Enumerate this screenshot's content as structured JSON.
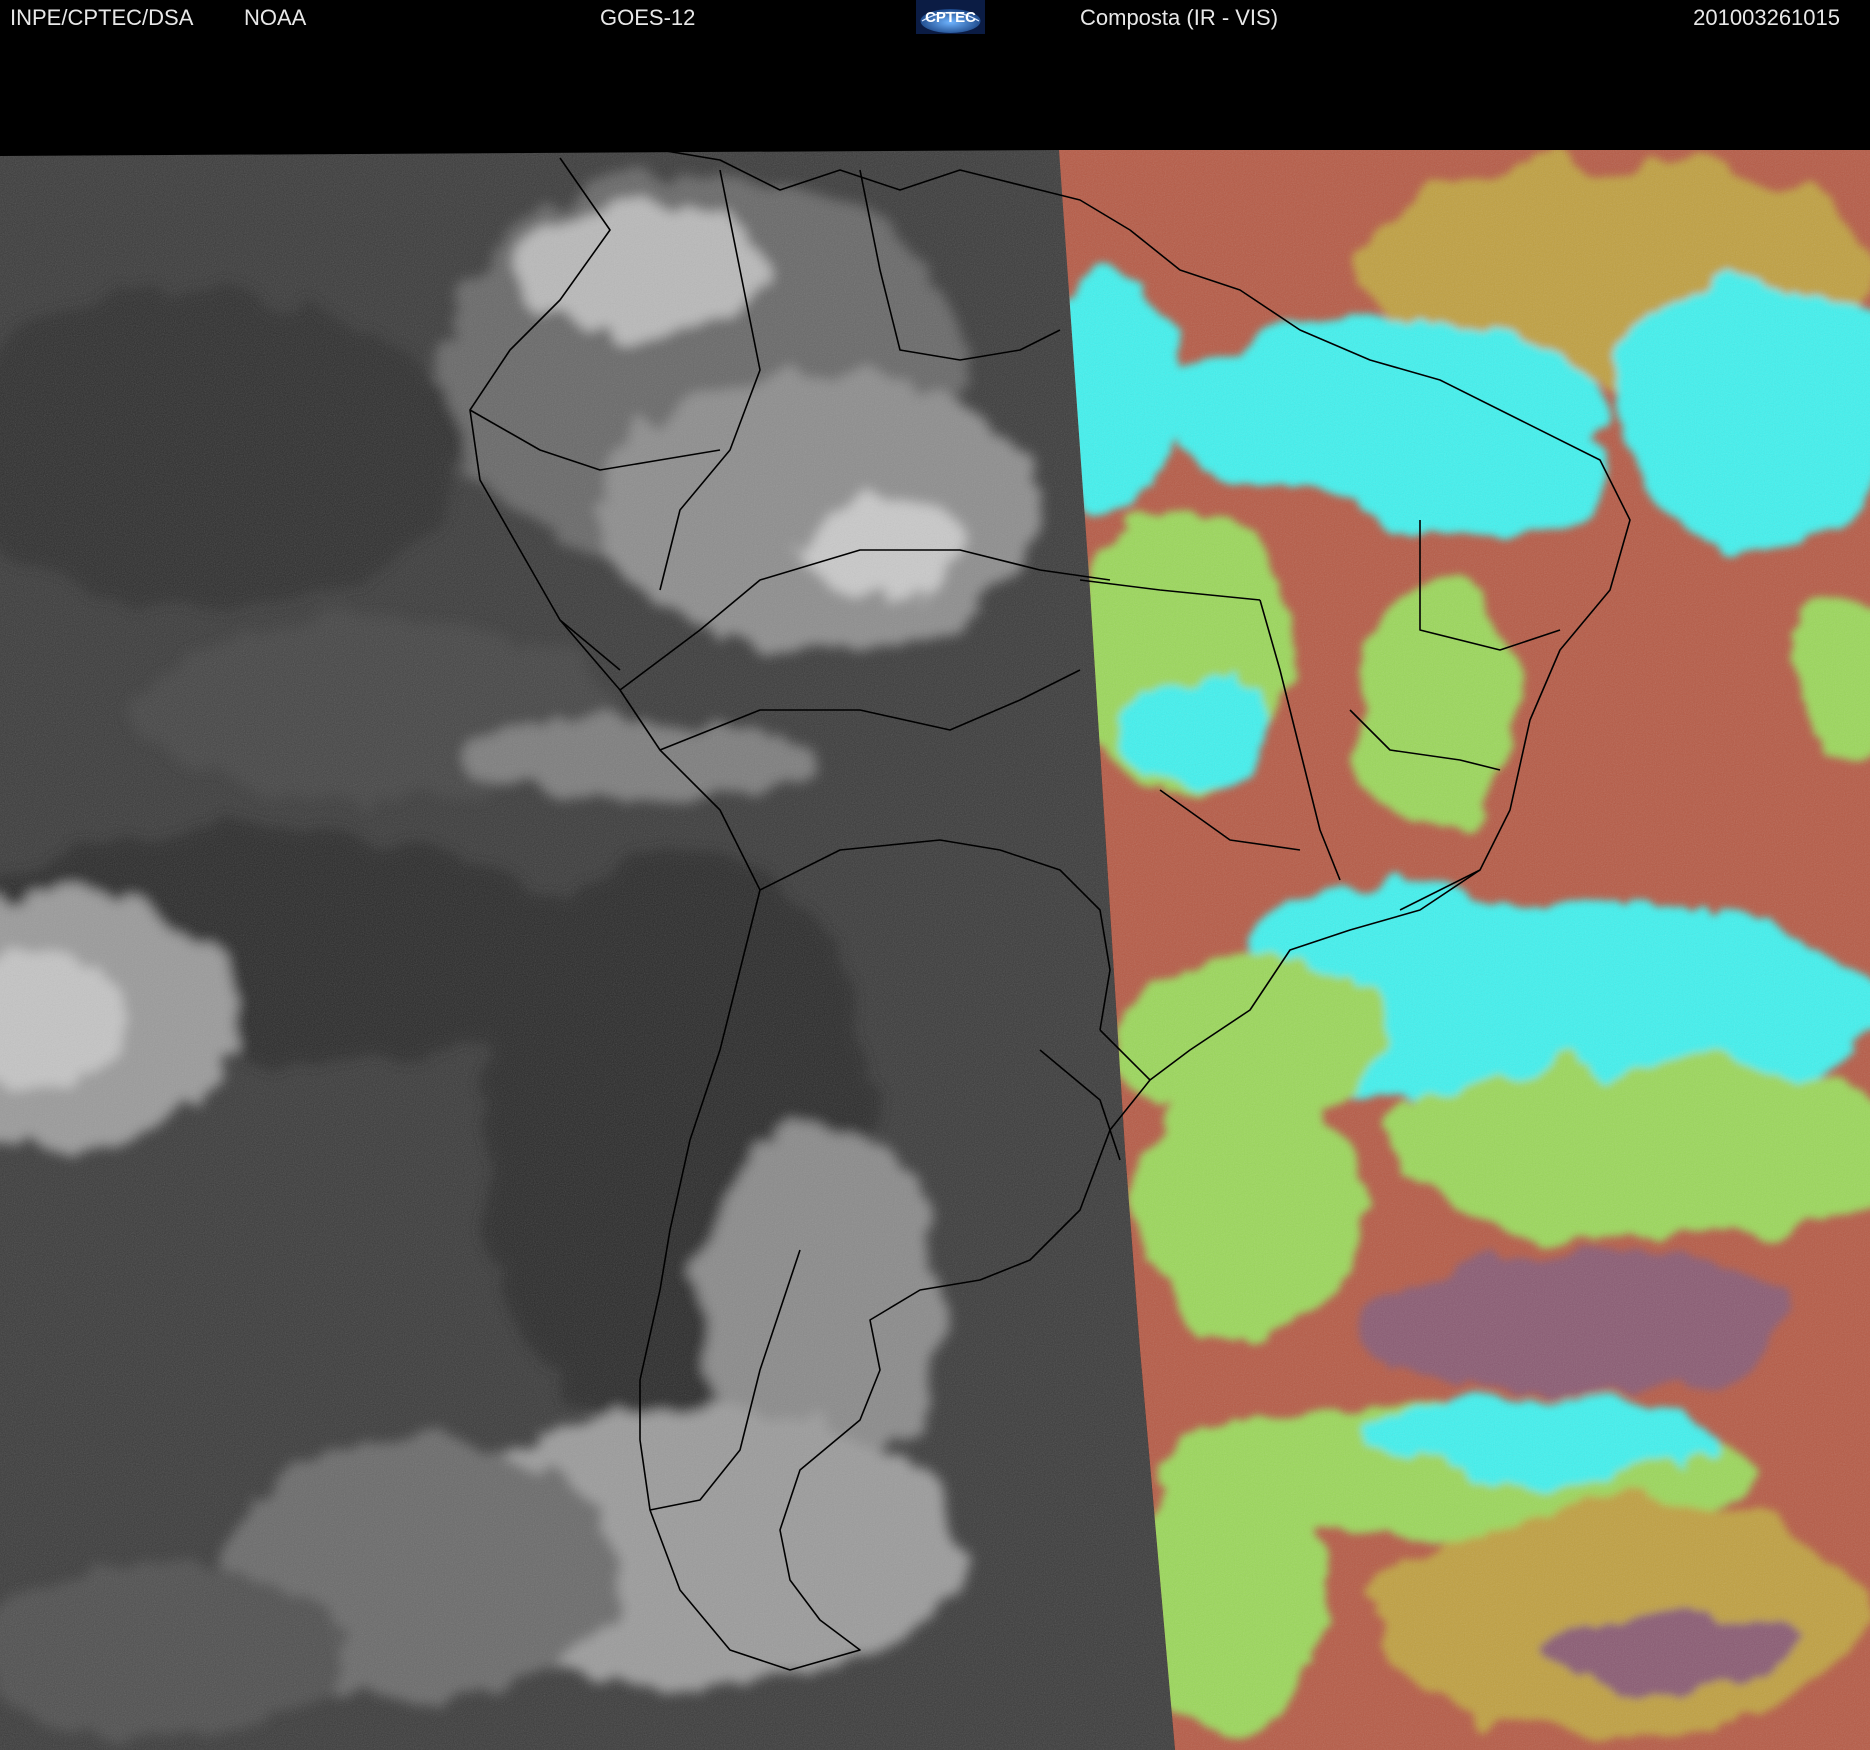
{
  "header": {
    "organization": "INPE/CPTEC/DSA",
    "agency": "NOAA",
    "satellite": "GOES-12",
    "logo_text": "CPTEC",
    "product": "Composta (IR - VIS)",
    "timestamp": "201003261015"
  },
  "imagery": {
    "ir_side_colors": [
      "#2a2a2a",
      "#3c3c3c",
      "#bdbdbd"
    ],
    "composite_colors": [
      "#b65a45",
      "#c0a040",
      "#9bd85a",
      "#3ff2ef",
      "#8a5a72"
    ],
    "border_color": "#000000"
  }
}
